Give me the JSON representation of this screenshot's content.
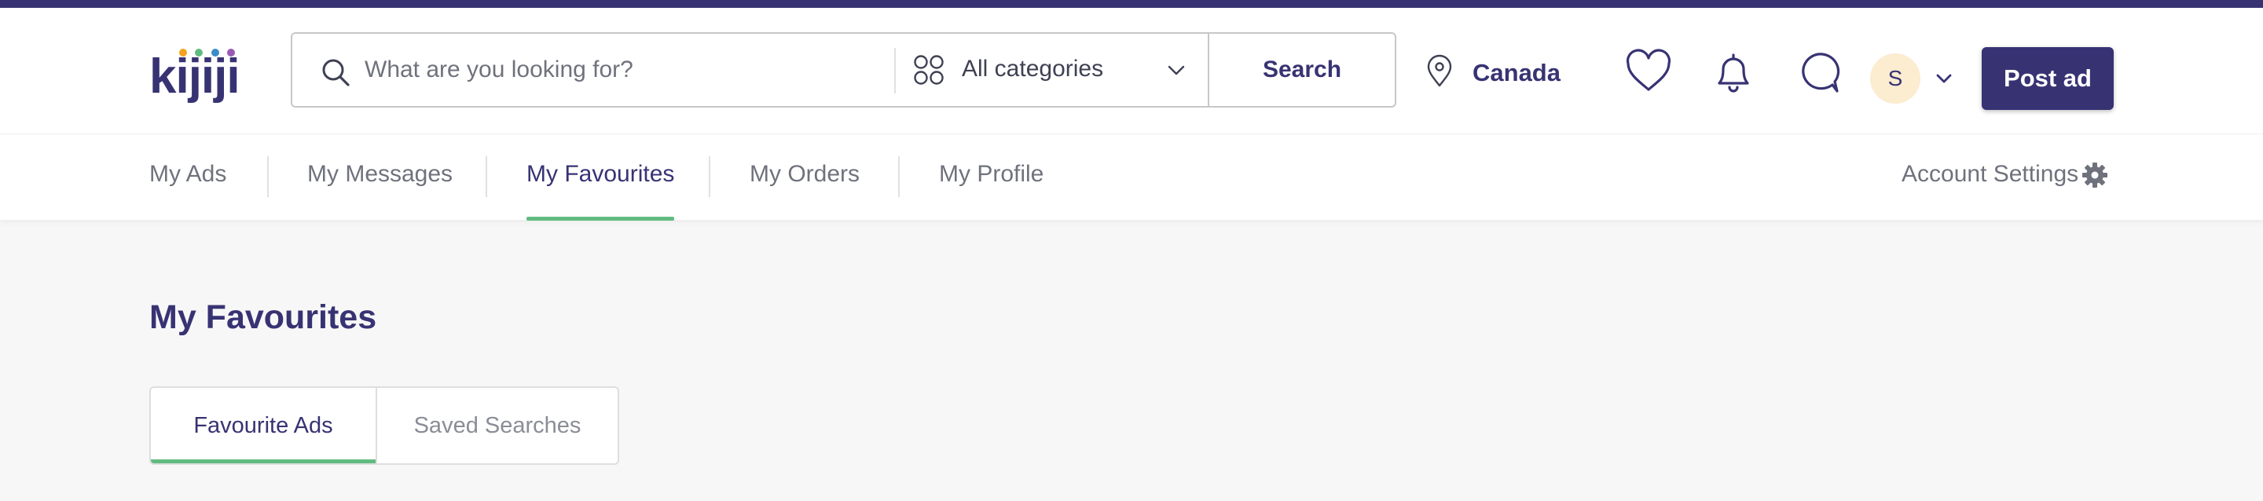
{
  "brand": {
    "name": "kijiji",
    "colors": {
      "primary": "#373373",
      "accent_green": "#61bb80",
      "dot_orange": "#f6a21c",
      "dot_green": "#61bb80",
      "dot_blue": "#3a8cc8",
      "dot_purple": "#9b59b6"
    }
  },
  "header": {
    "search": {
      "placeholder": "What are you looking for?",
      "value": "",
      "category_label": "All categories",
      "button_label": "Search"
    },
    "location_label": "Canada",
    "avatar_initial": "S",
    "post_ad_label": "Post ad",
    "icons": [
      "search-icon",
      "grid-icon",
      "chevron-down-icon",
      "location-pin-icon",
      "heart-icon",
      "bell-icon",
      "chat-bubble-icon",
      "gear-icon"
    ]
  },
  "subnav": {
    "tabs": [
      {
        "label": "My Ads",
        "active": false
      },
      {
        "label": "My Messages",
        "active": false
      },
      {
        "label": "My Favourites",
        "active": true
      },
      {
        "label": "My Orders",
        "active": false
      },
      {
        "label": "My Profile",
        "active": false
      }
    ],
    "account_settings_label": "Account Settings"
  },
  "main": {
    "title": "My Favourites",
    "tabs": [
      {
        "label": "Favourite Ads",
        "active": true
      },
      {
        "label": "Saved Searches",
        "active": false
      }
    ]
  }
}
